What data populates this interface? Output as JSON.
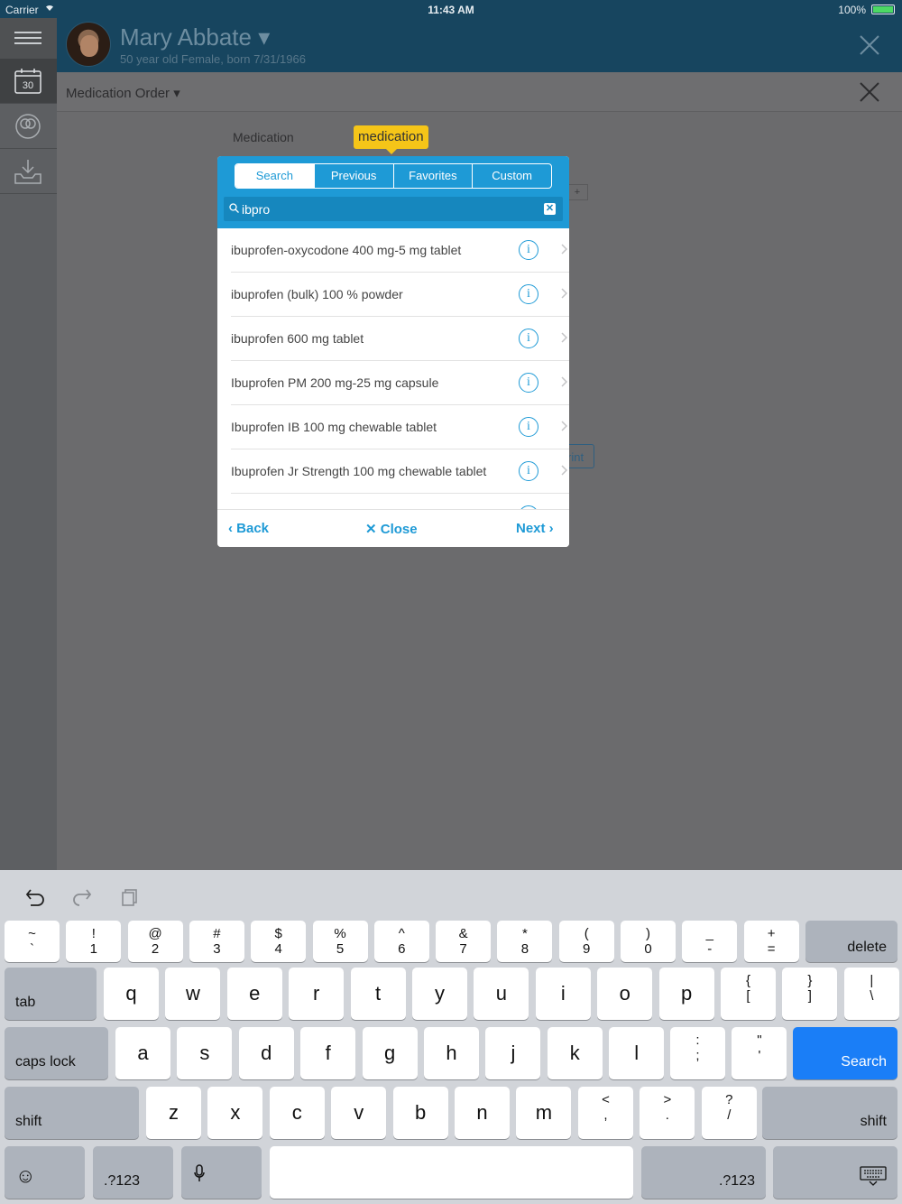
{
  "status": {
    "carrier": "Carrier",
    "time": "11:43 AM",
    "battery": "100%"
  },
  "patient": {
    "name": "Mary Abbate ▾",
    "info": "50 year old Female, born 7/31/1966"
  },
  "sidebar": {
    "calendar_day": "30"
  },
  "subheader": {
    "title": "Medication Order ▾"
  },
  "form": {
    "medication_label": "Medication",
    "tooltip": "medication",
    "plus": "+",
    "print_fragment": "rint"
  },
  "popup": {
    "tabs": [
      "Search",
      "Previous",
      "Favorites",
      "Custom"
    ],
    "search_value": "ibpro",
    "clear": "✕",
    "results": [
      "ibuprofen-oxycodone 400 mg-5 mg tablet",
      "ibuprofen (bulk) 100 % powder",
      "ibuprofen 600 mg tablet",
      "Ibuprofen PM 200 mg-25 mg capsule",
      "Ibuprofen IB 100 mg chewable tablet",
      "Ibuprofen Jr Strength 100 mg chewable tablet"
    ],
    "info_glyph": "i",
    "back": "‹ Back",
    "close": "✕ Close",
    "next": "Next ›"
  },
  "keyboard": {
    "row1": [
      [
        "~",
        "`"
      ],
      [
        "!",
        "1"
      ],
      [
        "@",
        "2"
      ],
      [
        "#",
        "3"
      ],
      [
        "$",
        "4"
      ],
      [
        "%",
        "5"
      ],
      [
        "^",
        "6"
      ],
      [
        "&",
        "7"
      ],
      [
        "*",
        "8"
      ],
      [
        "(",
        "9"
      ],
      [
        ")",
        "0"
      ],
      [
        "_",
        "-"
      ],
      [
        "+",
        "="
      ]
    ],
    "row2": [
      "q",
      "w",
      "e",
      "r",
      "t",
      "y",
      "u",
      "i",
      "o",
      "p"
    ],
    "row2_sym": [
      [
        "{",
        "["
      ],
      [
        "}",
        "]"
      ],
      [
        "|",
        "\\"
      ]
    ],
    "row3": [
      "a",
      "s",
      "d",
      "f",
      "g",
      "h",
      "j",
      "k",
      "l"
    ],
    "row3_sym": [
      [
        ":",
        ";"
      ],
      [
        "\"",
        "'"
      ]
    ],
    "row4": [
      "z",
      "x",
      "c",
      "v",
      "b",
      "n",
      "m"
    ],
    "row4_sym": [
      [
        "<",
        ","
      ],
      [
        ">",
        "."
      ],
      [
        "?",
        "/"
      ]
    ],
    "delete": "delete",
    "tab": "tab",
    "caps": "caps lock",
    "search": "Search",
    "shift": "shift",
    "num": ".?123",
    "emoji": "☺"
  }
}
